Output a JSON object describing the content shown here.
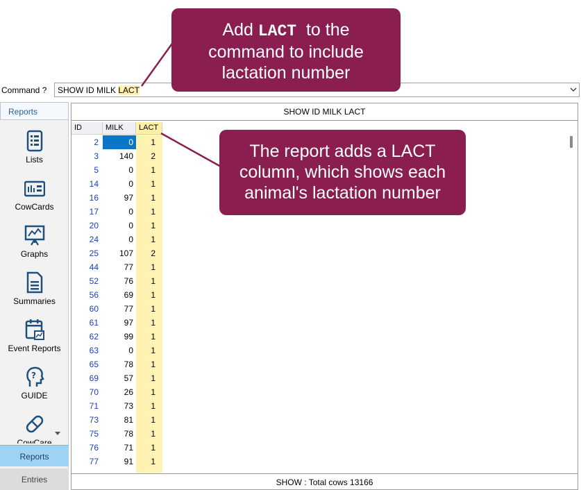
{
  "command_bar": {
    "label": "Command ?",
    "value_prefix": "SHOW ID MILK ",
    "value_highlight": "LACT"
  },
  "sidebar": {
    "header": "Reports",
    "items": [
      {
        "label": "Lists",
        "icon": "list-icon"
      },
      {
        "label": "CowCards",
        "icon": "cowcard-icon"
      },
      {
        "label": "Graphs",
        "icon": "graph-icon"
      },
      {
        "label": "Summaries",
        "icon": "summary-icon"
      },
      {
        "label": "Event Reports",
        "icon": "event-report-icon"
      },
      {
        "label": "GUIDE",
        "icon": "guide-icon"
      },
      {
        "label": "CowCare",
        "icon": "capsule-icon"
      }
    ],
    "tabs": {
      "reports": "Reports",
      "entries": "Entries"
    }
  },
  "report": {
    "title": "SHOW ID MILK LACT",
    "columns": [
      "ID",
      "MILK",
      "LACT"
    ],
    "rows": [
      [
        "2",
        "0",
        "1"
      ],
      [
        "3",
        "140",
        "2"
      ],
      [
        "5",
        "0",
        "1"
      ],
      [
        "14",
        "0",
        "1"
      ],
      [
        "16",
        "97",
        "1"
      ],
      [
        "17",
        "0",
        "1"
      ],
      [
        "20",
        "0",
        "1"
      ],
      [
        "24",
        "0",
        "1"
      ],
      [
        "25",
        "107",
        "2"
      ],
      [
        "44",
        "77",
        "1"
      ],
      [
        "52",
        "76",
        "1"
      ],
      [
        "56",
        "69",
        "1"
      ],
      [
        "60",
        "77",
        "1"
      ],
      [
        "61",
        "97",
        "1"
      ],
      [
        "62",
        "99",
        "1"
      ],
      [
        "63",
        "0",
        "1"
      ],
      [
        "65",
        "78",
        "1"
      ],
      [
        "69",
        "57",
        "1"
      ],
      [
        "70",
        "26",
        "1"
      ],
      [
        "71",
        "73",
        "1"
      ],
      [
        "73",
        "81",
        "1"
      ],
      [
        "75",
        "78",
        "1"
      ],
      [
        "76",
        "71",
        "1"
      ],
      [
        "77",
        "91",
        "1"
      ]
    ],
    "footer": "SHOW : Total cows  13166"
  },
  "callouts": {
    "first": {
      "line1_pre": "Add ",
      "line1_code": "LACT",
      "line1_post": "  to the",
      "line2": "command to include",
      "line3": "lactation number"
    },
    "second": {
      "line1": "The report adds a LACT",
      "line2": "column, which shows each",
      "line3": "animal's lactation number"
    }
  },
  "colors": {
    "callout": "#8a1e50",
    "highlight": "#fff3b4",
    "selection": "#0a75c9",
    "id_text": "#1a3fb5",
    "active_tab": "#9fd3f3"
  }
}
